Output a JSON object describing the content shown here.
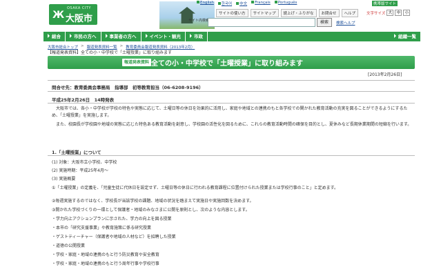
{
  "header": {
    "logo_en": "OSAKA CITY",
    "logo_jp": "大阪市",
    "logo_mark": "Ж",
    "languages": [
      "English",
      "한국어",
      "中文",
      "Français",
      "Português"
    ],
    "mobile_link": "携帯版サイト",
    "util_links": [
      "サイトの使い方",
      "サイトマップ",
      "読上げ・ふりがな",
      "お問合せ",
      "ヘルプ"
    ],
    "font_size_label": "文字サイズ",
    "font_sizes": [
      "大",
      "中",
      "小"
    ],
    "search_label": "サイト内検索",
    "search_placeholder": "",
    "search_button": "検索",
    "search_help": "検索ヘルプ"
  },
  "nav": {
    "items": [
      "総合",
      "市民の方へ",
      "事業者の方へ",
      "イベント・観光",
      "市政"
    ],
    "right_item": "組織一覧"
  },
  "breadcrumbs": [
    "大阪市総合トップ",
    "報道発表資料一覧",
    "教育委員会報道発表資料（2013年2月）"
  ],
  "current_path": "【報道発表資料】全ての小・中学校で「土曜授業」に取り組みます",
  "title": {
    "tag": "報道発表資料",
    "text": "全ての小・中学校で「土曜授業」に取り組みます"
  },
  "date_right": "[2013年2月26日]",
  "contact": "問合せ先：教育委員会事務局　指導部　初等教育担当（06-6208-9196）",
  "pub_date": "平成25年2月26日　14時発表",
  "paragraphs": [
    "大阪市では、各小・中学校が学校の特色や実態に応じて、土曜日等の休日を効果的に活用し、家庭や地域との連携のもと各学校での関かれた教育活動の充実を図ることができるようにするため、「土曜授業」を実施します。",
    "また、校園長が学校園や地域の実態に応じた特色ある教育活動を創意し、学校園の活性化を図るために、これらの教育活動時間の確保を目的とし、夏休みなど長期休業期間の短縮を行います。"
  ],
  "section_title": "1.「土曜授業」について",
  "items": [
    "(1) 対象：大阪市立小学校、中学校",
    "(2) 実施時期：平成25年4月〜",
    "(3) 実施概要",
    "①「土曜授業」の定義を、「児童生徒に代休日を設定せず、土曜日等の休日に行われる教育課程に位置付けられた授業または学校行事のこと」と定めます。",
    "②毎週実施するのではなく、学校長が当該学校の課題、地域の状況を踏まえて実施日や実施回数を決めます。",
    "③開かれた学校づくりの一環として保護者・地域のみなさまに公開を原則とし、次のような内容とします。",
    "・学力向上アクションプランに示された、学力の向上を図る授業",
    "・本市の「研究支援事業」や教育施策に係る研究授業",
    "・ゲストティーチャー（保護者や地域の人材など）を招聘した授業",
    "・道徳の公開授業",
    "・学校・家庭・地域の連携のもと行う防災教育や安全教育",
    "・学校・家庭・地域の連携のもと行う周年行事や学校行事"
  ]
}
